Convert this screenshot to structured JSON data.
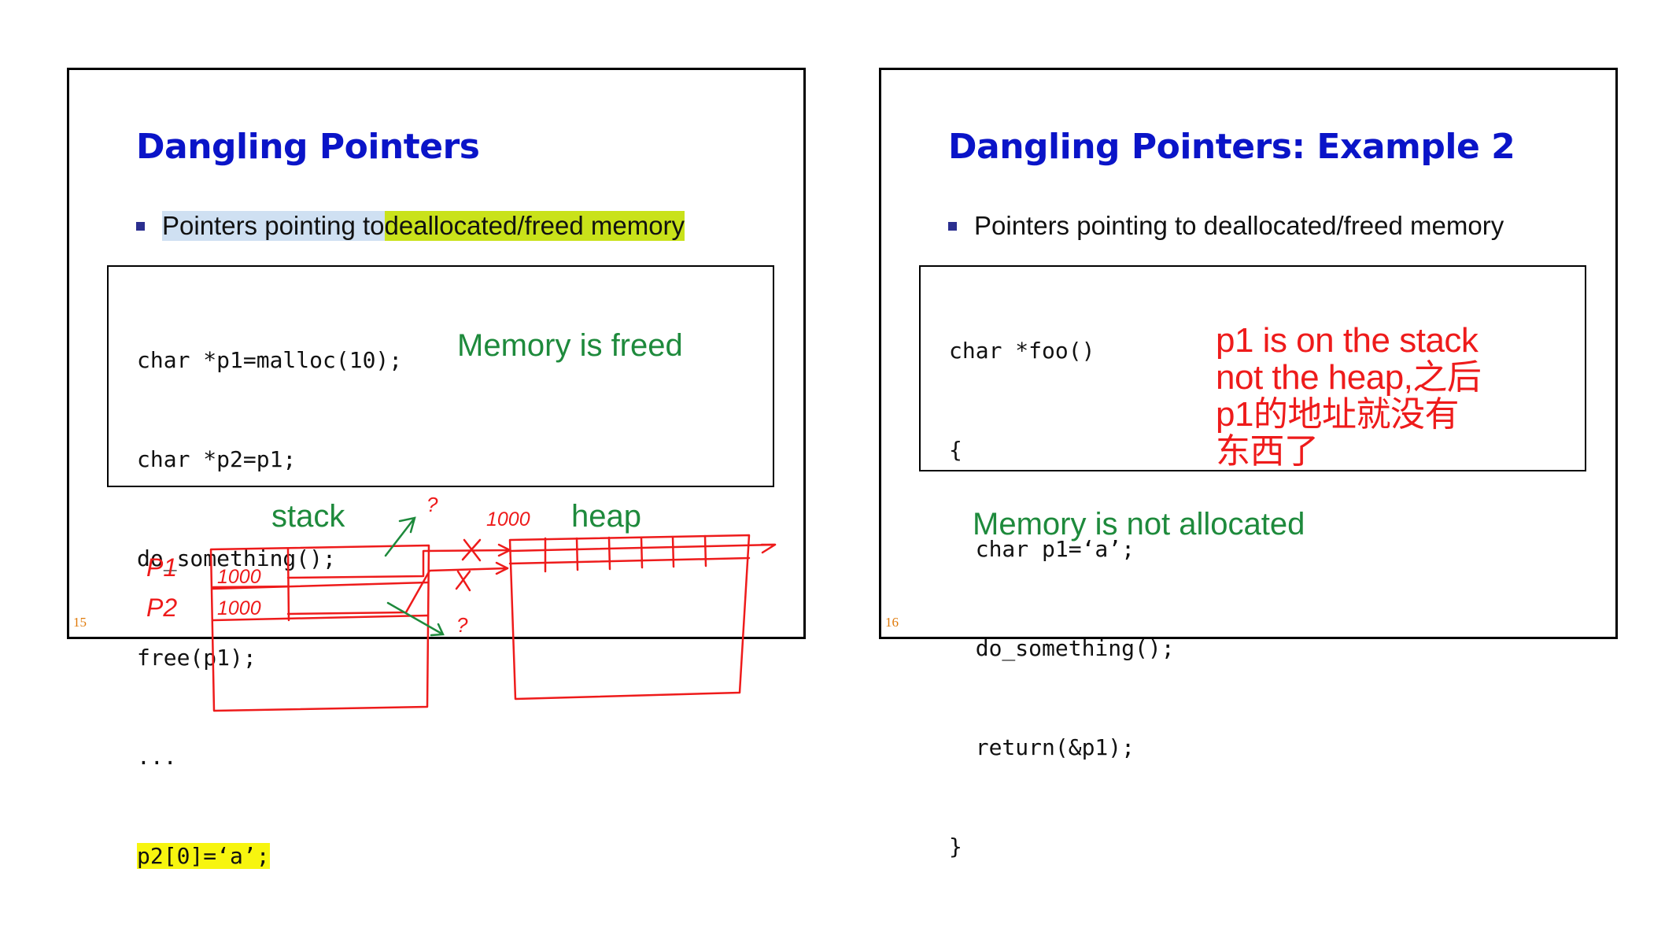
{
  "slide1": {
    "title": "Dangling Pointers",
    "bullet_part1": "Pointers pointing to ",
    "bullet_part2": "deallocated/freed memory",
    "code": [
      "char *p1=malloc(10);",
      "char *p2=p1;",
      "do_something();",
      "free(p1);",
      "...",
      "p2[0]=‘a’;"
    ],
    "annotation": "Memory is freed",
    "page_number": "15"
  },
  "slide2": {
    "title": "Dangling Pointers: Example 2",
    "bullet": "Pointers pointing to deallocated/freed memory",
    "code": [
      "char *foo()",
      "{",
      "  char p1=‘a’;",
      "  do_something();",
      "  return(&p1);",
      "}"
    ],
    "annotation": "Memory is not allocated",
    "page_number": "16"
  },
  "handwriting": {
    "stack_label": "stack",
    "heap_label": "heap",
    "p1_label": "P1",
    "p2_label": "P2",
    "p1_value": "1000",
    "p2_value": "1000",
    "address_label": "1000",
    "question_mark": "?",
    "red_note": [
      "p1 is on the stack",
      "not the heap,之后",
      "p1的地址就没有",
      "东西了"
    ]
  },
  "colors": {
    "title": "#0a14c8",
    "annotation_green": "#1e8a3c",
    "ink_red": "#ee1b1b",
    "highlight_blue": "#cfe0f2",
    "highlight_green_yellow": "#c9e21a",
    "highlight_yellow": "#f7f50f",
    "page_number": "#e07a0a"
  }
}
